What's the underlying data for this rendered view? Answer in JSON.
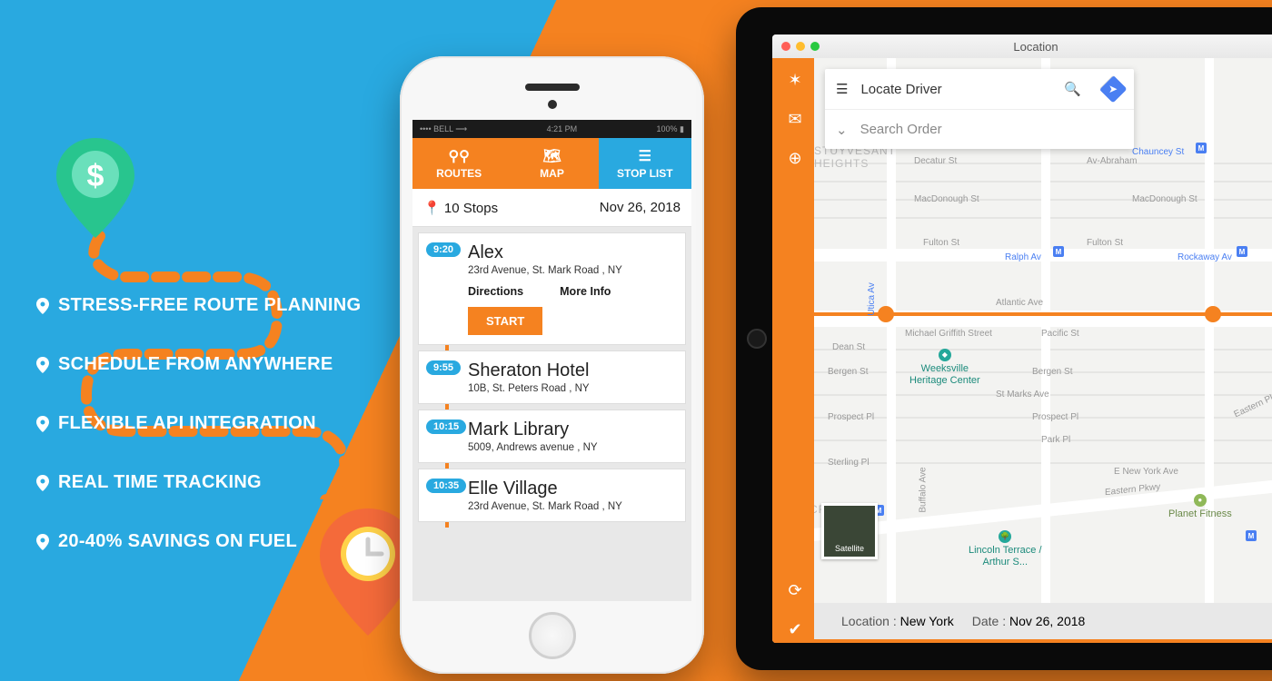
{
  "features": [
    "STRESS-FREE ROUTE PLANNING",
    "SCHEDULE FROM ANYWHERE",
    "FLEXIBLE API INTEGRATION",
    "REAL TIME TRACKING",
    "20-40% SAVINGS ON FUEL"
  ],
  "phone": {
    "status": {
      "left": "•••• BELL ⟶",
      "time": "4:21 PM",
      "right": "100% ▮"
    },
    "tabs": {
      "routes": "ROUTES",
      "map": "MAP",
      "stoplist": "STOP LIST"
    },
    "stops_bar": {
      "count": "10 Stops",
      "date": "Nov 26, 2018"
    },
    "stops": [
      {
        "time": "9:20",
        "name": "Alex",
        "addr": "23rd Avenue, St. Mark Road , NY",
        "directions": "Directions",
        "more": "More Info",
        "start": "START"
      },
      {
        "time": "9:55",
        "name": "Sheraton Hotel",
        "addr": "10B, St. Peters Road , NY"
      },
      {
        "time": "10:15",
        "name": "Mark Library",
        "addr": "5009,  Andrews avenue , NY"
      },
      {
        "time": "10:35",
        "name": "Elle Village",
        "addr": "23rd Avenue, St. Mark Road , NY"
      }
    ]
  },
  "tablet": {
    "window_title": "Location",
    "search": {
      "main": "Locate Driver",
      "sub": "Search Order"
    },
    "roads": {
      "atlantic": "Atlantic Ave",
      "fulton": "Fulton St",
      "eastern": "Eastern Pkwy",
      "ralph": "Ralph Av",
      "utica": "Utica Av",
      "rockaway": "Rockaway Av",
      "chauncey": "Chauncey St",
      "decatur": "Decatur St",
      "macdonough": "MacDonough St",
      "bergen": "Bergen St",
      "stmarks": "St Marks Ave",
      "prospect": "Prospect Pl",
      "park": "Park Pl",
      "sterling": "Sterling Pl",
      "dean": "Dean St",
      "pacific": "Pacific St",
      "ny_ave": "E New York Ave",
      "michael": "Michael Griffith Street",
      "buffalo": "Buffalo Ave",
      "av_abraham": "Av-Abraham"
    },
    "poi": {
      "weeksville": "Weeksville\nHeritage Center",
      "lincoln": "Lincoln Terrace /\nArthur S...",
      "planet": "Planet Fitness",
      "stuy": "STUYVESANT\nHEIGHTS",
      "crown": "CROWN"
    },
    "sat_label": "Satellite",
    "footer": {
      "loc_label": "Location :",
      "loc": "New York",
      "date_label": "Date :",
      "date": "Nov 26, 2018"
    }
  }
}
